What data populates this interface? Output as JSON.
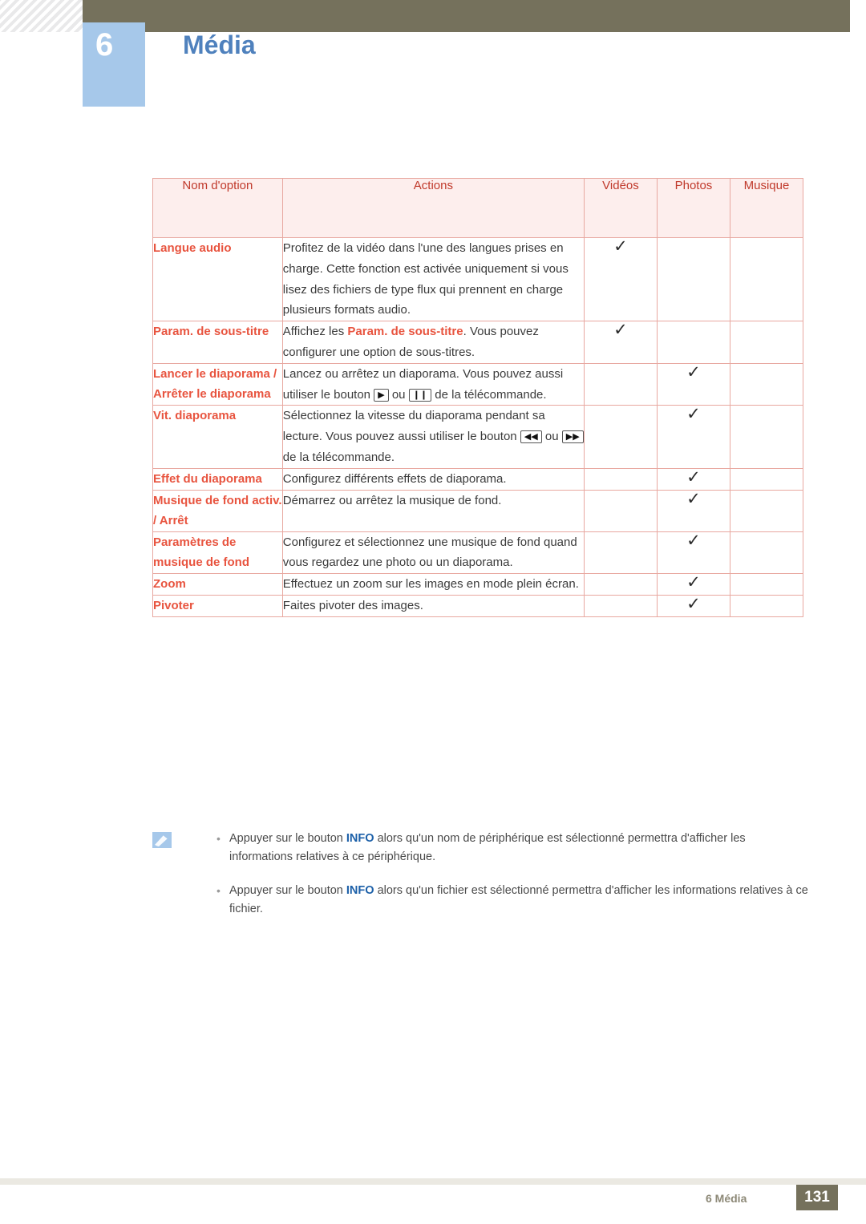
{
  "header": {
    "chapter_number": "6",
    "chapter_title": "Média"
  },
  "table": {
    "columns": [
      "Nom d'option",
      "Actions",
      "Vidéos",
      "Photos",
      "Musique"
    ],
    "rows": [
      {
        "name": "Langue audio",
        "action_pre": "Profitez de la vidéo dans l'une des langues prises en charge. Cette fonction est activée uniquement si vous lisez des fichiers de type flux qui prennent en charge plusieurs formats audio.",
        "videos": "✓",
        "photos": "",
        "musique": ""
      },
      {
        "name": "Param. de sous-titre",
        "action_pre": "Affichez les ",
        "action_hl": "Param. de sous-titre",
        "action_post": ". Vous pouvez configurer une option de sous-titres.",
        "videos": "✓",
        "photos": "",
        "musique": ""
      },
      {
        "name": "Lancer le diaporama / Arrêter le diaporama",
        "action_pre": "Lancez ou arrêtez un diaporama. Vous pouvez aussi utiliser le bouton ",
        "glyph1": "▶",
        "action_mid": " ou ",
        "glyph2": "❙❙",
        "action_post": " de la télécommande.",
        "videos": "",
        "photos": "✓",
        "musique": ""
      },
      {
        "name": "Vit. diaporama",
        "action_pre": "Sélectionnez la vitesse du diaporama pendant sa lecture. Vous pouvez aussi utiliser le bouton ",
        "glyph1": "◀◀",
        "action_mid": " ou ",
        "glyph2": "▶▶",
        "action_post": " de la télécommande.",
        "videos": "",
        "photos": "✓",
        "musique": ""
      },
      {
        "name": "Effet du diaporama",
        "action_pre": "Configurez différents effets de diaporama.",
        "videos": "",
        "photos": "✓",
        "musique": ""
      },
      {
        "name": "Musique de fond activ. / Arrêt",
        "action_pre": "Démarrez ou arrêtez la musique de fond.",
        "videos": "",
        "photos": "✓",
        "musique": ""
      },
      {
        "name": "Paramètres de musique de fond",
        "action_pre": "Configurez et sélectionnez une musique de fond quand vous regardez une photo ou un diaporama.",
        "videos": "",
        "photos": "✓",
        "musique": ""
      },
      {
        "name": "Zoom",
        "action_pre": "Effectuez un zoom sur les images en mode plein écran.",
        "videos": "",
        "photos": "✓",
        "musique": ""
      },
      {
        "name": "Pivoter",
        "action_pre": "Faites pivoter des images.",
        "videos": "",
        "photos": "✓",
        "musique": ""
      }
    ]
  },
  "notes": {
    "icon_name": "note-pencil-icon",
    "items": [
      {
        "pre": "Appuyer sur le bouton ",
        "keyword": "INFO",
        "post": " alors qu'un nom de périphérique est sélectionné permettra d'afficher les informations relatives à ce périphérique."
      },
      {
        "pre": "Appuyer sur le bouton ",
        "keyword": "INFO",
        "post": " alors qu'un fichier est sélectionné permettra d'afficher les informations relatives à ce fichier."
      }
    ]
  },
  "footer": {
    "label": "6 Média",
    "page": "131"
  },
  "colors": {
    "accent_blue": "#4f81bd",
    "chapter_box": "#a6c8ea",
    "header_olive": "#75715c",
    "table_border": "#e8a8a0",
    "table_head_bg": "#fdeeed",
    "option_red": "#e8543f",
    "header_text_red": "#c0392b",
    "info_blue": "#1b5fa8"
  }
}
